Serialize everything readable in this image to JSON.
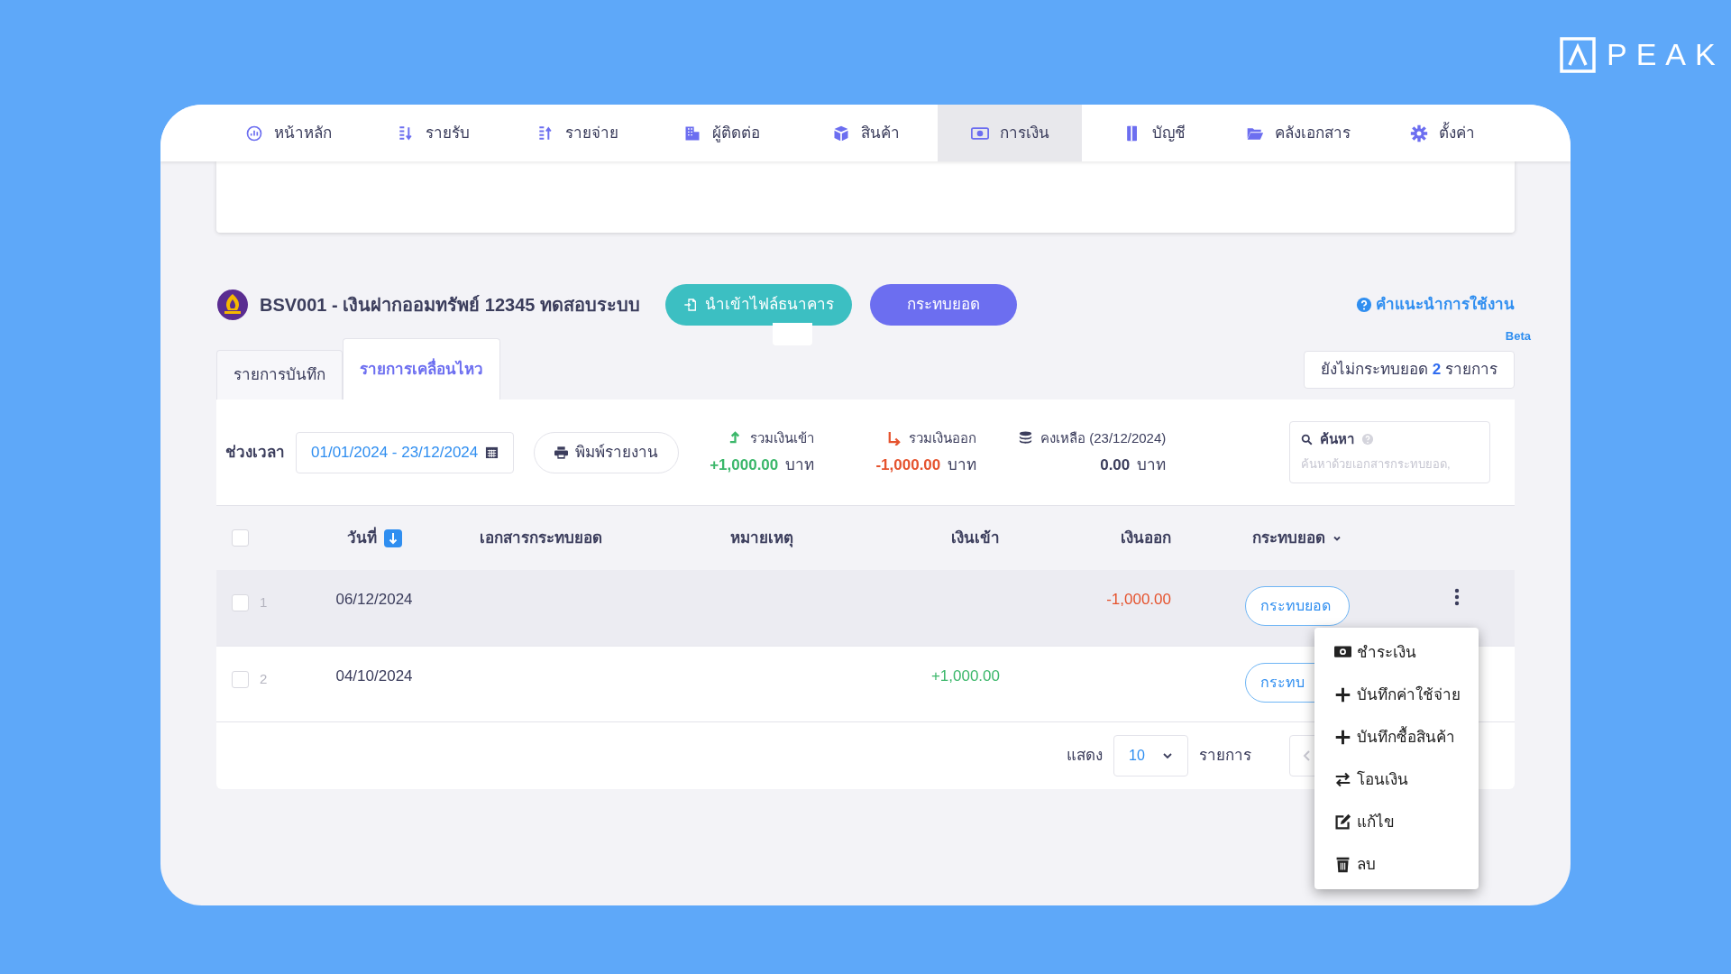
{
  "logo": {
    "text": "PEAK"
  },
  "nav": [
    {
      "label": "หน้าหลัก",
      "selected": false
    },
    {
      "label": "รายรับ",
      "selected": false
    },
    {
      "label": "รายจ่าย",
      "selected": false
    },
    {
      "label": "ผู้ติดต่อ",
      "selected": false
    },
    {
      "label": "สินค้า",
      "selected": false
    },
    {
      "label": "การเงิน",
      "selected": true
    },
    {
      "label": "บัญชี",
      "selected": false
    },
    {
      "label": "คลังเอกสาร",
      "selected": false
    },
    {
      "label": "ตั้งค่า",
      "selected": false
    }
  ],
  "account": {
    "title": "BSV001 - เงินฝากออมทรัพย์ 12345 ทดสอบระบบ",
    "import_button": "นำเข้าไฟล์ธนาคาร",
    "reconcile_button": "กระทบยอด",
    "help_link": "คำแนะนำการใช้งาน",
    "beta": "Beta"
  },
  "tabs": [
    {
      "label": "รายการบันทึก",
      "selected": false
    },
    {
      "label": "รายการเคลื่อนไหว",
      "selected": true
    }
  ],
  "unreconciled": {
    "before": "ยังไม่กระทบยอด",
    "count": "2",
    "after": "รายการ"
  },
  "filters": {
    "period_label": "ช่วงเวลา",
    "period_value": "01/01/2024 - 23/12/2024",
    "print_button": "พิมพ์รายงาน",
    "summary": [
      {
        "kind": "in",
        "label": "รวมเงินเข้า",
        "amount": "+1,000.00",
        "unit": "บาท"
      },
      {
        "kind": "out",
        "label": "รวมเงินออก",
        "amount": "-1,000.00",
        "unit": "บาท"
      },
      {
        "kind": "balance",
        "label": "คงเหลือ (23/12/2024)",
        "amount": "0.00",
        "unit": "บาท"
      }
    ],
    "search": {
      "label": "ค้นหา",
      "placeholder": "ค้นหาด้วยเอกสารกระทบยอด,"
    }
  },
  "table": {
    "header_checked": false,
    "columns": [
      "วันที่",
      "เอกสารกระทบยอด",
      "หมายเหตุ",
      "เงินเข้า",
      "เงินออก",
      "กระทบยอด"
    ],
    "rows": [
      {
        "checked": false,
        "number": "1",
        "date": "06/12/2024",
        "money_in": "",
        "money_out": "-1,000.00",
        "action": "กระทบยอด",
        "hover": true
      },
      {
        "checked": false,
        "number": "2",
        "date": "04/10/2024",
        "money_in": "+1,000.00",
        "money_out": "",
        "action": "กระทบ",
        "hover": false
      }
    ]
  },
  "pagination": {
    "show_label": "แสดง",
    "page_size": "10",
    "items_label": "รายการ"
  },
  "menu": [
    {
      "label": "ชำระเงิน"
    },
    {
      "label": "บันทึกค่าใช้จ่าย"
    },
    {
      "label": "บันทึกซื้อสินค้า"
    },
    {
      "label": "โอนเงิน"
    },
    {
      "label": "แก้ไข"
    },
    {
      "label": "ลบ"
    }
  ]
}
